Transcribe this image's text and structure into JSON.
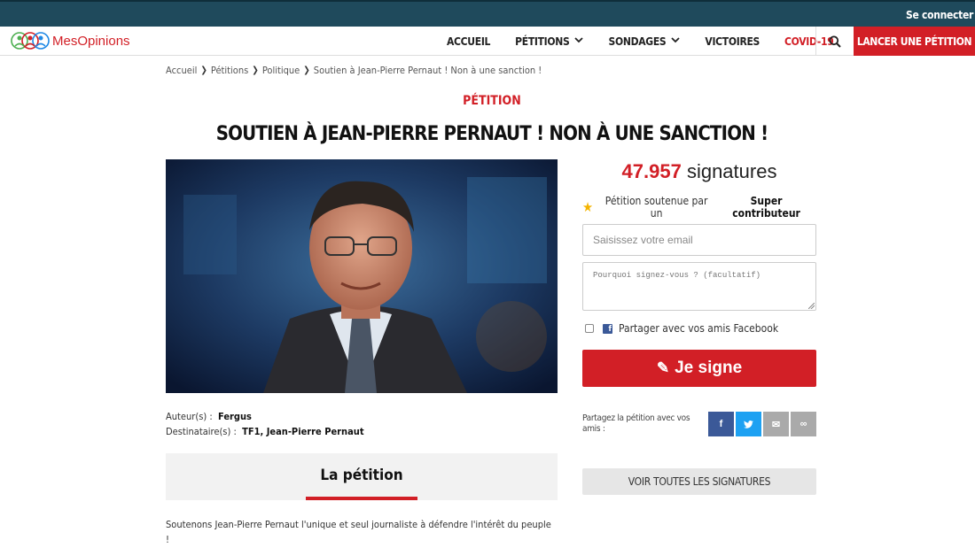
{
  "topbar": {
    "login_label": "Se connecter"
  },
  "nav": {
    "brand": "MesOpinions",
    "items": [
      {
        "label": "ACCUEIL",
        "dropdown": false
      },
      {
        "label": "PÉTITIONS",
        "dropdown": true
      },
      {
        "label": "SONDAGES",
        "dropdown": true
      },
      {
        "label": "VICTOIRES",
        "dropdown": false
      },
      {
        "label": "COVID-19",
        "dropdown": false
      }
    ],
    "search_icon": "search-icon",
    "cta_label": "LANCER UNE PÉTITION"
  },
  "breadcrumb": [
    "Accueil",
    "Pétitions",
    "Politique",
    "Soutien à Jean-Pierre Pernaut ! Non à une sanction !"
  ],
  "petition": {
    "kicker": "PÉTITION",
    "title": "SOUTIEN À JEAN-PIERRE PERNAUT ! NON À UNE SANCTION !",
    "author_label": "Auteur(s) :",
    "author": "Fergus",
    "recipients_label": "Destinataire(s) :",
    "recipients": "TF1, Jean-Pierre Pernaut",
    "tab_label": "La pétition",
    "description": "Soutenons Jean-Pierre Pernaut l'unique et seul journaliste à défendre l'intérêt du peuple !"
  },
  "sign_panel": {
    "count": "47.957",
    "count_unit": "signatures",
    "supported_text": "Pétition soutenue par un",
    "supported_by": "Super contributeur",
    "email_placeholder": "Saisissez votre email",
    "reason_placeholder": "Pourquoi signez-vous ? (facultatif)",
    "facebook_share_label": "Partager avec vos amis Facebook",
    "facebook_share_checked": false,
    "sign_button": "Je signe",
    "share_label": "Partagez la pétition avec vos amis :",
    "share_buttons": [
      {
        "icon": "facebook-icon",
        "glyph": "f",
        "color": "#3b5998"
      },
      {
        "icon": "twitter-icon",
        "glyph": "t",
        "color": "#1da1f2"
      },
      {
        "icon": "email-icon",
        "glyph": "✉",
        "color": "#aaaaaa"
      },
      {
        "icon": "link-icon",
        "glyph": "∞",
        "color": "#aaaaaa"
      }
    ],
    "all_signatures_button": "VOIR TOUTES LES SIGNATURES"
  },
  "colors": {
    "accent": "#d21f26",
    "topbar": "#1f4a5c",
    "facebook": "#3b5998",
    "twitter": "#1da1f2"
  }
}
